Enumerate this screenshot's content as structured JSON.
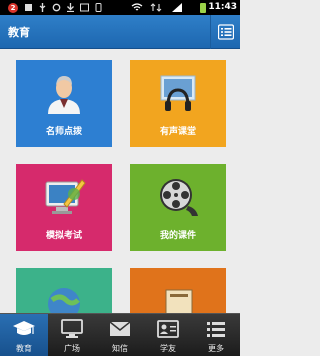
{
  "status_bar": {
    "notification_count": "2",
    "time": "11:43"
  },
  "header": {
    "title": "教育",
    "menu_icon": "list-menu-icon"
  },
  "tiles": [
    {
      "label": "名师点拨",
      "icon": "teacher-icon",
      "color": "#2d7fd2"
    },
    {
      "label": "有声课堂",
      "icon": "headphones-icon",
      "color": "#f2a51f"
    },
    {
      "label": "模拟考试",
      "icon": "computer-pen-icon",
      "color": "#d62a6c"
    },
    {
      "label": "我的课件",
      "icon": "film-reel-icon",
      "color": "#6db12d"
    },
    {
      "label": "",
      "icon": "globe-icon",
      "color": "#3cb28a"
    },
    {
      "label": "",
      "icon": "book-icon",
      "color": "#e0731b"
    }
  ],
  "tabbar": {
    "items": [
      {
        "label": "教育",
        "icon": "graduation-cap-icon",
        "active": true
      },
      {
        "label": "广场",
        "icon": "monitor-icon",
        "active": false
      },
      {
        "label": "知信",
        "icon": "envelope-icon",
        "active": false
      },
      {
        "label": "学友",
        "icon": "contact-card-icon",
        "active": false
      },
      {
        "label": "更多",
        "icon": "more-list-icon",
        "active": false
      }
    ]
  }
}
